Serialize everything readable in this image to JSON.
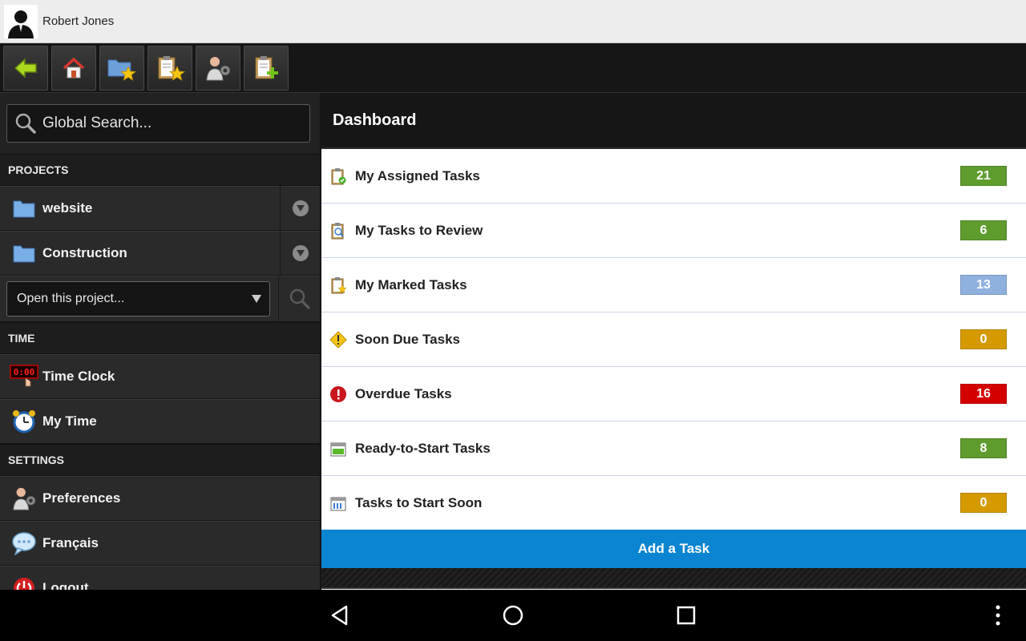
{
  "user": {
    "name": "Robert Jones"
  },
  "toolbar": {
    "buttons": [
      {
        "name": "back",
        "icon": "arrow-left-icon"
      },
      {
        "name": "home",
        "icon": "home-icon"
      },
      {
        "name": "favorite-projects",
        "icon": "folder-star-icon"
      },
      {
        "name": "favorite-tasks",
        "icon": "clipboard-star-icon"
      },
      {
        "name": "user-settings",
        "icon": "user-gear-icon"
      },
      {
        "name": "new-task",
        "icon": "clipboard-add-icon"
      }
    ]
  },
  "sidebar": {
    "search": {
      "placeholder": "Global Search..."
    },
    "projects_heading": "PROJECTS",
    "projects": [
      {
        "label": "website"
      },
      {
        "label": "Construction"
      }
    ],
    "open_project": {
      "placeholder": "Open this project..."
    },
    "time_heading": "TIME",
    "time_items": [
      {
        "label": "Time Clock"
      },
      {
        "label": "My Time"
      }
    ],
    "settings_heading": "SETTINGS",
    "settings_items": [
      {
        "label": "Preferences"
      },
      {
        "label": "Français"
      },
      {
        "label": "Logout"
      }
    ]
  },
  "dashboard": {
    "title": "Dashboard",
    "tasks": [
      {
        "label": "My Assigned Tasks",
        "count": "21",
        "color": "#5e9c2e"
      },
      {
        "label": "My Tasks to Review",
        "count": "6",
        "color": "#5e9c2e"
      },
      {
        "label": "My Marked Tasks",
        "count": "13",
        "color": "#8fb1de"
      },
      {
        "label": "Soon Due Tasks",
        "count": "0",
        "color": "#d49a00"
      },
      {
        "label": "Overdue Tasks",
        "count": "16",
        "color": "#d40000"
      },
      {
        "label": "Ready-to-Start Tasks",
        "count": "8",
        "color": "#5e9c2e"
      },
      {
        "label": "Tasks to Start Soon",
        "count": "0",
        "color": "#d49a00"
      }
    ],
    "add_task_label": "Add a Task"
  },
  "colors": {
    "accent": "#0b84d1",
    "toolbar_bg": "#161616"
  }
}
